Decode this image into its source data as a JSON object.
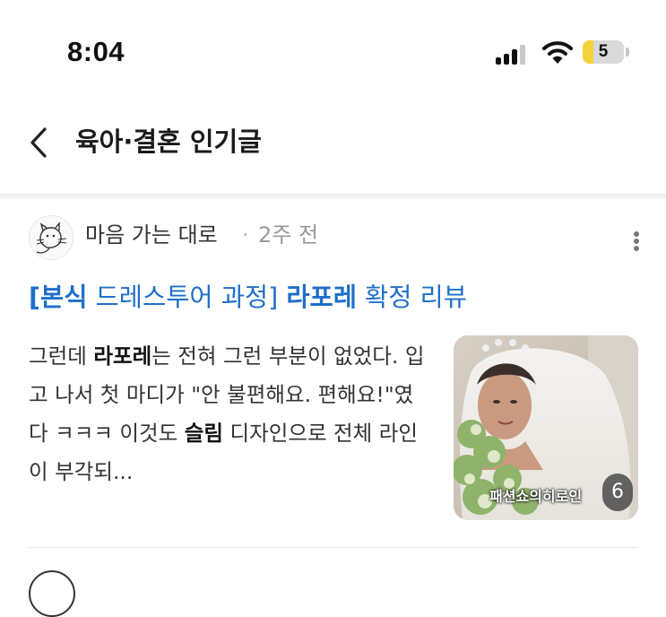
{
  "status_bar": {
    "time": "8:04",
    "battery": "5",
    "battery_level": 0.25,
    "signal_bars": 3,
    "signal_max": 4,
    "icons": [
      "signal-icon",
      "wifi-icon",
      "battery-icon"
    ]
  },
  "header": {
    "back_icon": "chevron-left-icon",
    "title": "육아·결혼 인기글"
  },
  "post": {
    "author": "마음 가는 대로",
    "separator": "·",
    "time": "2주 전",
    "more_icon": "more-vertical-icon",
    "title_prefix": "[본식",
    "title_mid": " 드레스투어 과정] ",
    "title_brand": "라포레",
    "title_suffix": " 확정 리뷰",
    "excerpt_1": "그런데 ",
    "excerpt_bold_1": "라포레",
    "excerpt_2": "는 전혀 그런 부분이 없었다. 입고 나서 첫 마디가 \"안 불편해요. 편해요!\"였다 ㅋㅋㅋ 이것도 ",
    "excerpt_bold_2": "슬림",
    "excerpt_3": " 디자인으로 전체 라인이 부각되...",
    "thumbnail_caption": "패션쇼의히로인",
    "photo_count": "6"
  },
  "colors": {
    "link_blue": "#1f6fc9",
    "battery_yellow": "#f4d23c",
    "text_dark": "#1a1a1a"
  }
}
